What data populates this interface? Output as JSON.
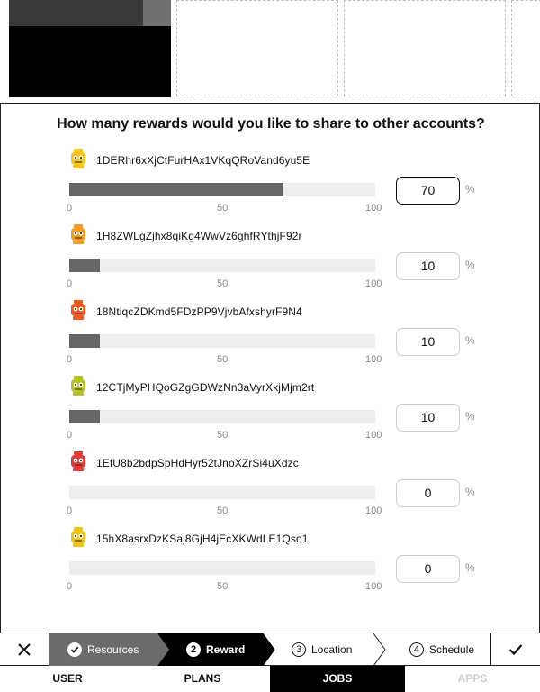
{
  "question": "How many rewards would you like to share to other accounts?",
  "ticks": [
    "0",
    "50",
    "100"
  ],
  "unit": "%",
  "rows": [
    {
      "account": "1DERhr6xXjCtFurHAx1VKqQRoVand6yu5E",
      "value": "70",
      "percent": 70,
      "avatar": "yellow-robot-avatar-icon",
      "color": "#f5c518"
    },
    {
      "account": "1H8ZWLgZjhx8qiKg4WwVz6ghfRYthjF92r",
      "value": "10",
      "percent": 10,
      "avatar": "orange-robot-avatar-icon",
      "color": "#f59b1c"
    },
    {
      "account": "18NtiqcZDKmd5FDzPP9VjvbAfxshyrF9N4",
      "value": "10",
      "percent": 10,
      "avatar": "red-orange-robot-avatar-icon",
      "color": "#f2581e"
    },
    {
      "account": "12CTjMyPHQoGZgGDWzNn3aVyrXkjMjm2rt",
      "value": "10",
      "percent": 10,
      "avatar": "olive-robot-avatar-icon",
      "color": "#b4c41c"
    },
    {
      "account": "1EfU8b2bdpSpHdHyr52tJnoXZrSi4uXdzc",
      "value": "0",
      "percent": 0,
      "avatar": "red-robot-avatar-icon",
      "color": "#e53935"
    },
    {
      "account": "15hX8asrxDzKSaj8GjH4jEcXKWdLE1Qso1",
      "value": "0",
      "percent": 0,
      "avatar": "yellow-eye-robot-avatar-icon",
      "color": "#f2c40f"
    }
  ],
  "stepper": {
    "steps": [
      {
        "number": "",
        "label": "Resources",
        "state": "done"
      },
      {
        "number": "2",
        "label": "Reward",
        "state": "current"
      },
      {
        "number": "3",
        "label": "Location",
        "state": "upcoming"
      },
      {
        "number": "4",
        "label": "Schedule",
        "state": "upcoming"
      }
    ]
  },
  "tabs": [
    {
      "label": "USER",
      "state": "normal"
    },
    {
      "label": "PLANS",
      "state": "normal"
    },
    {
      "label": "JOBS",
      "state": "active"
    },
    {
      "label": "APPS",
      "state": "disabled"
    }
  ]
}
